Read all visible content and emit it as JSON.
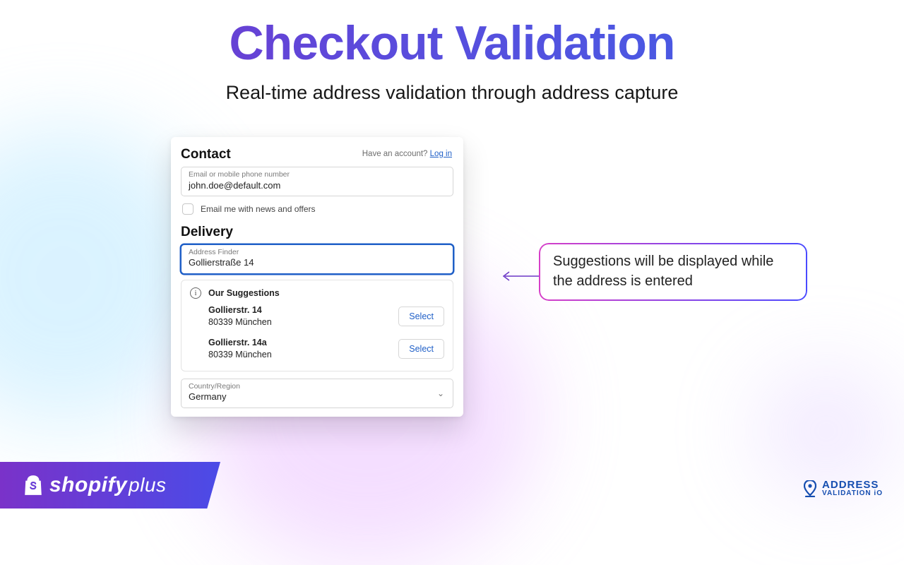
{
  "headline": "Checkout Validation",
  "subhead": "Real-time address validation through address capture",
  "card": {
    "contact_heading": "Contact",
    "account_prompt": "Have an account?",
    "login_link": "Log in",
    "email_label": "Email or mobile phone number",
    "email_value": "john.doe@default.com",
    "news_checkbox_label": "Email me with news and offers",
    "delivery_heading": "Delivery",
    "address_finder_label": "Address Finder",
    "address_finder_value": "Gollierstraße 14",
    "suggestions_title": "Our Suggestions",
    "suggestions": [
      {
        "line1": "Gollierstr. 14",
        "line2": "80339 München",
        "button": "Select"
      },
      {
        "line1": "Gollierstr. 14a",
        "line2": "80339 München",
        "button": "Select"
      }
    ],
    "country_label": "Country/Region",
    "country_value": "Germany"
  },
  "callout": "Suggestions will be displayed while the address is entered",
  "badges": {
    "shopify": "shopifyplus",
    "avio_line1": "ADDRESS",
    "avio_line2": "VALIDATION iO"
  }
}
